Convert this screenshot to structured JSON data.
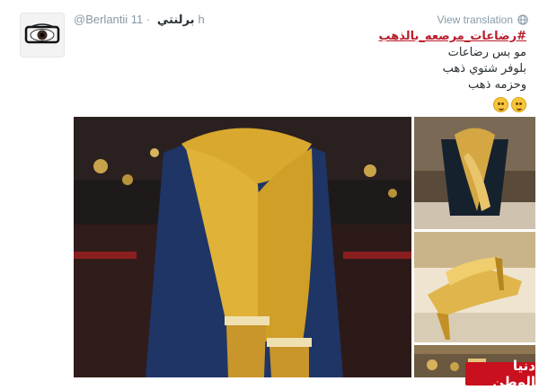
{
  "tweet": {
    "handle": "@Berlantii",
    "name": "برلنتي",
    "time": "11h",
    "view_translation": "View translation",
    "hashtag": "#رضاعات_مرصعه_بالذهب",
    "lines": [
      "مو بس رضاعات",
      "بلوفر شتوي ذهب",
      "وحزمه ذهب"
    ],
    "emojis": [
      "thinking-face-emoji",
      "smiling-face-emoji"
    ]
  },
  "watermark": "دنيا الوطن",
  "colors": {
    "hashtag": "#b91d2c",
    "meta": "#8899a6",
    "watermark_bg": "#c8101e"
  }
}
